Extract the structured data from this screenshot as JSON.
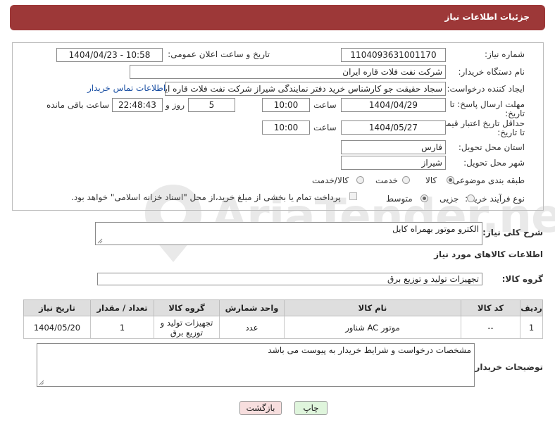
{
  "header": {
    "title": "جزئیات اطلاعات نیاز"
  },
  "form": {
    "need_number_label": "شماره نیاز:",
    "need_number": "1104093631001170",
    "announce_label": "تاریخ و ساعت اعلان عمومی:",
    "announce_value": "1404/04/23 - 10:58",
    "buyer_org_label": "نام دستگاه خریدار:",
    "buyer_org": "شرکت نفت فلات قاره ایران",
    "requester_label": "ایجاد کننده درخواست:",
    "requester": "سجاد حقیقت جو کارشناس خرید دفتر نمایندگی شیراز شرکت نفت فلات قاره ایر",
    "contact_link": "اطلاعات تماس خریدار",
    "deadline_label_1": "مهلت ارسال پاسخ: تا",
    "deadline_label_2": "تاریخ:",
    "deadline_date": "1404/04/29",
    "time_label": "ساعت",
    "deadline_time": "10:00",
    "days_value": "5",
    "days_label": "روز و",
    "remaining_time": "22:48:43",
    "remaining_label": "ساعت باقی مانده",
    "validity_label_1": "حداقل تاریخ اعتبار قیمت:",
    "validity_label_2": "تا تاریخ:",
    "validity_date": "1404/05/27",
    "validity_time": "10:00",
    "province_label": "استان محل تحویل:",
    "province": "فارس",
    "city_label": "شهر محل تحویل:",
    "city": "شیراز",
    "category_label": "طبقه بندی موضوعی:",
    "category_options": [
      "کالا",
      "خدمت",
      "کالا/خدمت"
    ],
    "category_selected": "کالا",
    "process_label": "نوع فرآیند خرید :",
    "process_options": [
      "جزیی",
      "متوسط"
    ],
    "process_selected": "متوسط",
    "payment_note": "پرداخت تمام یا بخشی از مبلغ خرید،از محل \"اسناد خزانه اسلامی\" خواهد بود."
  },
  "description": {
    "label": "شرح کلی نیاز:",
    "value": "الکترو موتور بهمراه کابل"
  },
  "goods_section_title": "اطلاعات کالاهای مورد نیاز",
  "goods_group": {
    "label": "گروه کالا:",
    "value": "تجهیزات تولید و توزیع برق"
  },
  "table": {
    "headers": [
      "ردیف",
      "کد کالا",
      "نام کالا",
      "واحد شمارش",
      "گروه کالا",
      "تعداد / مقدار",
      "تاریخ نیاز"
    ],
    "rows": [
      [
        "1",
        "--",
        "موتور AC شناور",
        "عدد",
        "تجهیزات تولید و توزیع برق",
        "1",
        "1404/05/20"
      ]
    ]
  },
  "buyer_notes": {
    "label": "توضیحات خریدار:",
    "value": "مشخصات درخواست و شرایط خریدار به پیوست می باشد"
  },
  "buttons": {
    "print": "چاپ",
    "back": "بازگشت"
  },
  "watermark": {
    "text": "AriaTender.net"
  },
  "colors": {
    "header_bg": "#9d3838",
    "link": "#1a4fa3",
    "back_button_bg": "#f7dede",
    "print_button_bg": "#dff5dc"
  }
}
